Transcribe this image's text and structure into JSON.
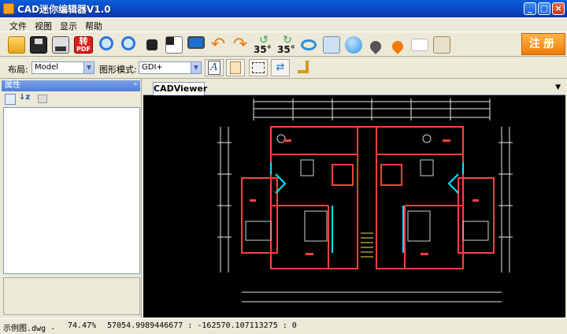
{
  "window": {
    "title": "CAD迷你编辑器V1.0",
    "min": "_",
    "max": "□",
    "close": "×"
  },
  "menu": [
    "文件",
    "视图",
    "显示",
    "帮助"
  ],
  "toolbar": {
    "convert_label": "转",
    "convert_sub": "PDF",
    "rotate_left_label": "35°",
    "rotate_right_label": "35°",
    "register_label": "注册"
  },
  "layout_bar": {
    "layout_label": "布局:",
    "layout_value": "Model",
    "graphics_label": "图形模式:",
    "graphics_value": "GDI+"
  },
  "properties": {
    "title": "属性",
    "pin": "ᵖ"
  },
  "tabs": [
    {
      "label": "CADViewer"
    }
  ],
  "status": {
    "file": "示例图.dwg -",
    "zoom": "74.47%",
    "coords": "57054.9989446677 : -162570.107113275 : 0"
  },
  "colors": {
    "title_bar": "#0a46c4",
    "drawing_bg": "#000000",
    "walls": "#ff4040",
    "dimensions": "#e8e8e8",
    "furniture": "#d0d0d0",
    "highlight": "#00e5ff",
    "register_button": "#f07a0a"
  }
}
